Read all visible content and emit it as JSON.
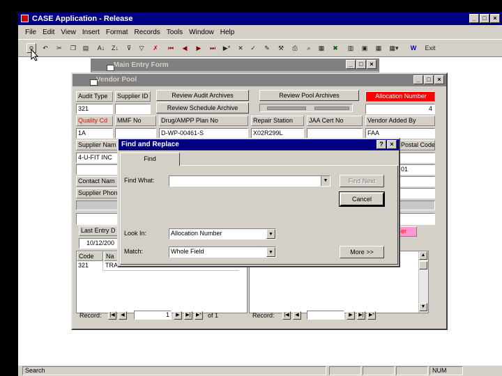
{
  "app": {
    "title": "CASE Application - Release",
    "menus": [
      "File",
      "Edit",
      "View",
      "Insert",
      "Format",
      "Records",
      "Tools",
      "Window",
      "Help"
    ],
    "toolbar_exit": "Exit",
    "status_left": "Search",
    "status_num": "NUM"
  },
  "main_entry_form": {
    "title": "Main Entry Form"
  },
  "vendor_pool": {
    "title": "Vendor Pool",
    "audit_type_label": "Audit Type",
    "supplier_id_label": "Supplier ID",
    "review_audit_archives": "Review Audit Archives",
    "review_pool_archives": "Review Pool Archives",
    "allocation_number_label": "Allocation Number",
    "review_schedule_archive": "Review Schedule Archive",
    "audit_type_value": "321",
    "allocation_number_value": "4",
    "quality_cd_label": "Quality Cd",
    "mmf_no_label": "MMF No",
    "drug_ampp_label": "Drug/AMPP Plan No",
    "repair_station_label": "Repair Station",
    "jaa_cert_label": "JAA Cert No",
    "vendor_added_by_label": "Vendor Added By",
    "quality_cd_value": "1A",
    "drug_ampp_value": "D-WP-00461-S",
    "repair_station_value": "X02R299L",
    "vendor_added_by_value": "FAA",
    "supplier_name_label": "Supplier Nam",
    "postal_code_label": "Postal Code",
    "supplier_name_value": "4-U-FIT INC",
    "postal_code_value": "01",
    "contact_name_label": "Contact Nam",
    "supplier_phone_label": "Supplier Phon",
    "last_entry_label": "Last Entry D",
    "last_entry_value": "10/12/200",
    "pink_label": "er",
    "code_col": "Code",
    "name_col": "Na",
    "row_code": "321",
    "row_name": "TRANSPORTATION",
    "record_label_left": "Record:",
    "record_value_left": "1",
    "record_of_left": "of 1",
    "record_label_right": "Record:"
  },
  "find_replace": {
    "title": "Find and Replace",
    "help_glyph": "?",
    "tab_find": "Find",
    "find_what_label": "Find What:",
    "find_what_value": "",
    "find_next_button": "Find Next",
    "cancel_button": "Cancel",
    "look_in_label": "Look In:",
    "look_in_value": "Allocation Number",
    "match_label": "Match:",
    "match_value": "Whole Field",
    "more_button": "More >>"
  },
  "colors": {
    "title_active": "#000080",
    "title_inactive": "#808080",
    "face": "#d4d0c8",
    "arrow_blue": "#0000ff",
    "alert_red": "#ff0000",
    "pink": "#ff99cc"
  }
}
